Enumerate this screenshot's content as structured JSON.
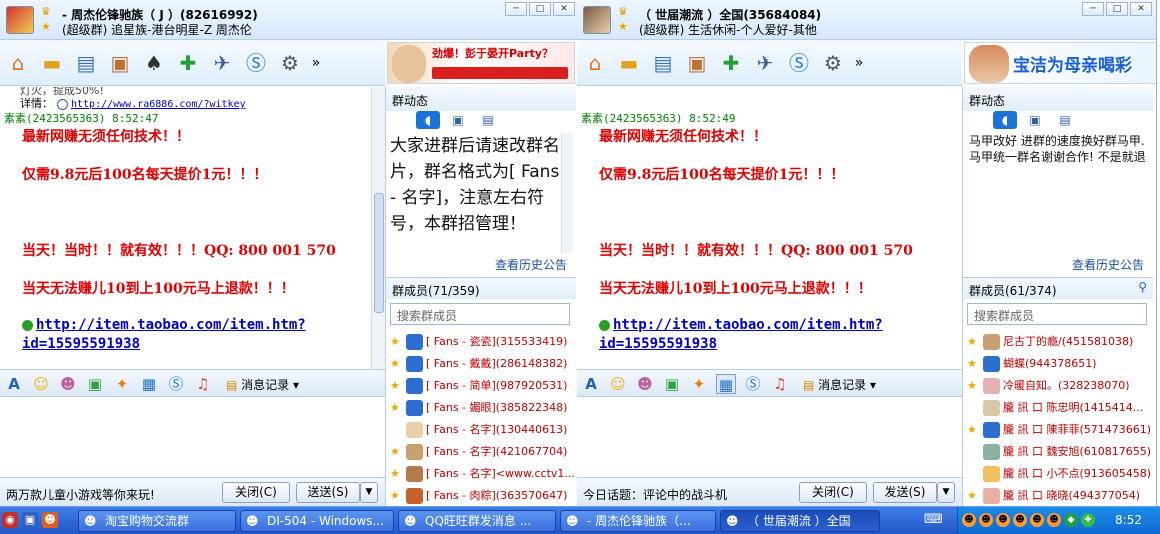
{
  "window1": {
    "title": "- 周杰伦锋驰族（ J ）(82616992)",
    "subtitle": "(超级群) 追星族-港台明星-Z 周杰伦",
    "ad_text": "劲爆！彭于晏开Party？",
    "chat": {
      "faded_line": "灯火，提成50%!",
      "detail_label": "详情：",
      "detail_link": "http://www.ra6886.com/?witkey",
      "sender": "素素(2423565363)  8:52:47",
      "lines": [
        "最新网赚无须任何技术！！",
        "仅需9.8元后100名每天提价1元！！！",
        "当天！当时！！就有效！！！QQ: 800 001 570",
        "当天无法赚儿10到上100元马上退款！！！"
      ],
      "link": "http://item.taobao.com/item.htm?id=15595591938"
    },
    "format_history": "消息记录",
    "bottom_text": "两万款儿童小游戏等你来玩!",
    "close_label": "关闭(C)",
    "send_label": "送送(S)",
    "side": {
      "header": "群动态",
      "notice": "大家进群后请速改群名片，群名格式为[ Fans - 名字]，注意左右符号，本群招管理！",
      "history_link": "查看历史公告",
      "members_header": "群成员(71/359)",
      "search_placeholder": "搜索群成员",
      "members": [
        {
          "name": "[ Fans - 瓷瓷](315533419)",
          "star": true,
          "avatar_color": "#2c6fd1"
        },
        {
          "name": "[ Fans - 戴戴](286148382)",
          "star": true,
          "avatar_color": "#2c6fd1"
        },
        {
          "name": "[ Fans - 简单](987920531)",
          "star": true,
          "avatar_color": "#2c6fd1"
        },
        {
          "name": "[ Fans - 媚眼](385822348)",
          "star": true,
          "avatar_color": "#2c6fd1"
        },
        {
          "name": "[ Fans - 名字](130440613)",
          "star": false,
          "avatar_color": "#e8cfa8"
        },
        {
          "name": "[ Fans - 名字](421067704)",
          "star": true,
          "avatar_color": "#c9a070"
        },
        {
          "name": "[ Fans - 名字]<www.cctv1...",
          "star": true,
          "avatar_color": "#b57a4a"
        },
        {
          "name": "[ Fans - 肉粽](363570647)",
          "star": true,
          "avatar_color": "#c86030"
        }
      ]
    }
  },
  "window2": {
    "title": "（ 世届潮流 ）全国(35684084)",
    "subtitle": "(超级群) 生活休闲-个人爱好-其他",
    "ad_text": "宝洁为母亲喝彩",
    "chat": {
      "sender": "素素(2423565363)  8:52:49",
      "lines": [
        "最新网赚无须任何技术！！",
        "仅需9.8元后100名每天提价1元！！！",
        "当天！当时！！就有效！！！QQ: 800 001 570",
        "当天无法赚儿10到上100元马上退款！！！"
      ],
      "link": "http://item.taobao.com/item.htm?id=15595591938"
    },
    "format_history": "消息记录",
    "bottom_text": "今日话题：评论中的战斗机",
    "close_label": "关闭(C)",
    "send_label": "发送(S)",
    "side": {
      "header": "群动态",
      "notice": "马甲改好 进群的速度换好群马甲. 马甲统一群名谢谢合作! 不是就退",
      "history_link": "查看历史公告",
      "members_header": "群成员(61/374)",
      "search_placeholder": "搜索群成员",
      "members": [
        {
          "name": "尼古丁的瘾/(451581038)",
          "star": true,
          "avatar_color": "#c9a070"
        },
        {
          "name": "蝴蝶(944378651)",
          "star": true,
          "avatar_color": "#2c6fd1"
        },
        {
          "name": "冷暖自知。(328238070)",
          "star": true,
          "avatar_color": "#e6b0b0"
        },
        {
          "name": "朧 訊 口 陈忠明(1415414...",
          "star": false,
          "avatar_color": "#d8c8a8"
        },
        {
          "name": "朧 訊 口 陳菲菲(571473661)",
          "star": true,
          "avatar_color": "#2c6fd1"
        },
        {
          "name": "朧 訊 口 魏安旭(610817655)",
          "star": false,
          "avatar_color": "#8ab0a0"
        },
        {
          "name": "朧 訊 口 小不点(913605458)",
          "star": false,
          "avatar_color": "#f0c060"
        },
        {
          "name": "朧 訊 口 晓晓(494377054)",
          "star": true,
          "avatar_color": "#e8b0a0"
        }
      ]
    }
  },
  "taskbar": {
    "tasks": [
      {
        "label": "淘宝购物交流群",
        "active": false
      },
      {
        "label": "DI-504 - Windows...",
        "active": false
      },
      {
        "label": "QQ旺旺群发消息 ...",
        "active": false
      },
      {
        "label": "- 周杰伦锋驰族（...",
        "active": false
      },
      {
        "label": "（ 世届潮流 ）全国",
        "active": true
      }
    ],
    "clock": "8:52"
  }
}
